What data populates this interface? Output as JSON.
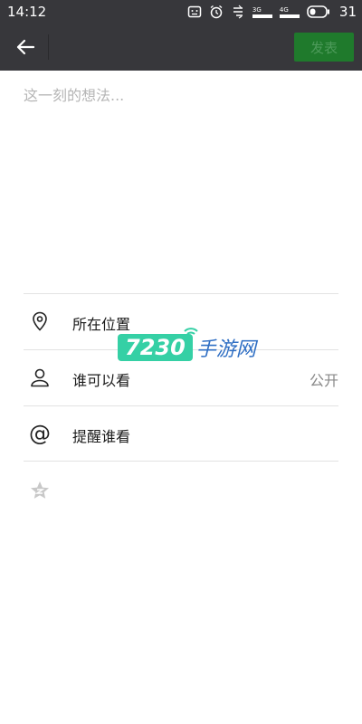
{
  "status_bar": {
    "time": "14:12",
    "net_3g": "3G",
    "net_4g": "4G",
    "battery": "31"
  },
  "app_bar": {
    "back_icon": "arrow-left-icon",
    "publish_label": "发表"
  },
  "compose": {
    "placeholder": "这一刻的想法..."
  },
  "options": [
    {
      "icon": "location-pin-icon",
      "label": "所在位置",
      "value": ""
    },
    {
      "icon": "person-icon",
      "label": "谁可以看",
      "value": "公开"
    },
    {
      "icon": "at-sign-icon",
      "label": "提醒谁看",
      "value": ""
    }
  ],
  "extra_icon": "star-icon",
  "watermark": {
    "badge": "7230",
    "text": "手游网"
  },
  "colors": {
    "bar": "#37373b",
    "publish_bg": "#1f7a2c",
    "publish_text": "#4d9a5a",
    "watermark_green": "#35d0a5",
    "watermark_blue": "#2f6fc4"
  }
}
